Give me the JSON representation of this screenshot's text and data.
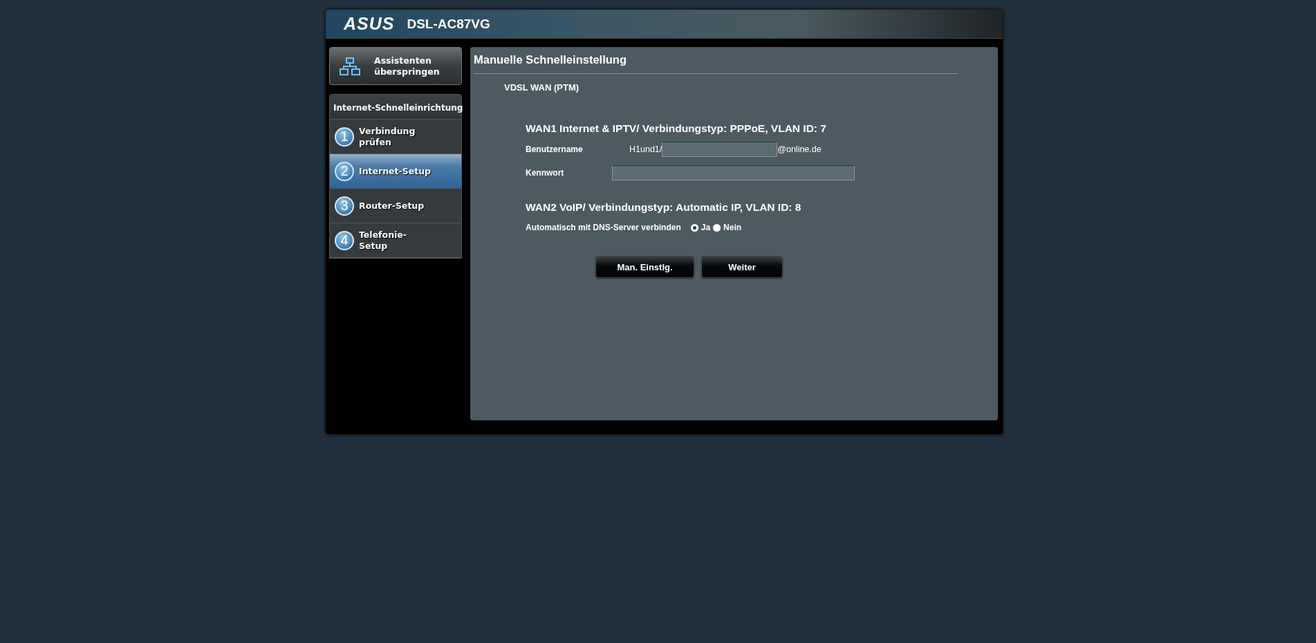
{
  "header": {
    "brand": "ASUS",
    "model": "DSL-AC87VG"
  },
  "skip_button": {
    "label": "Assistenten überspringen"
  },
  "sidebar": {
    "title": "Internet-Schnelleinrichtung",
    "items": [
      {
        "number": "1",
        "label": "Verbindung prüfen",
        "selected": false
      },
      {
        "number": "2",
        "label": "Internet-Setup",
        "selected": true
      },
      {
        "number": "3",
        "label": "Router-Setup",
        "selected": false
      },
      {
        "number": "4",
        "label": "Telefonie-Setup",
        "selected": false
      }
    ]
  },
  "content": {
    "title": "Manuelle Schnelleinstellung",
    "subtitle": "VDSL WAN (PTM)",
    "wan1": {
      "heading": "WAN1  Internet & IPTV/ Verbindungstyp:  PPPoE,  VLAN ID: 7",
      "username": {
        "label": "Benutzername",
        "prefix": "H1und1/",
        "suffix": "@online.de"
      },
      "password": {
        "label": "Kennwort"
      }
    },
    "wan2": {
      "heading": "WAN2  VoIP/ Verbindungstyp:  Automatic IP,  VLAN ID: 8",
      "dns": {
        "label": "Automatisch mit DNS-Server verbinden",
        "options": [
          {
            "label": "Ja",
            "selected": true
          },
          {
            "label": "Nein",
            "selected": false
          }
        ]
      }
    },
    "buttons": [
      "Man. Einstlg.",
      "Weiter"
    ]
  }
}
